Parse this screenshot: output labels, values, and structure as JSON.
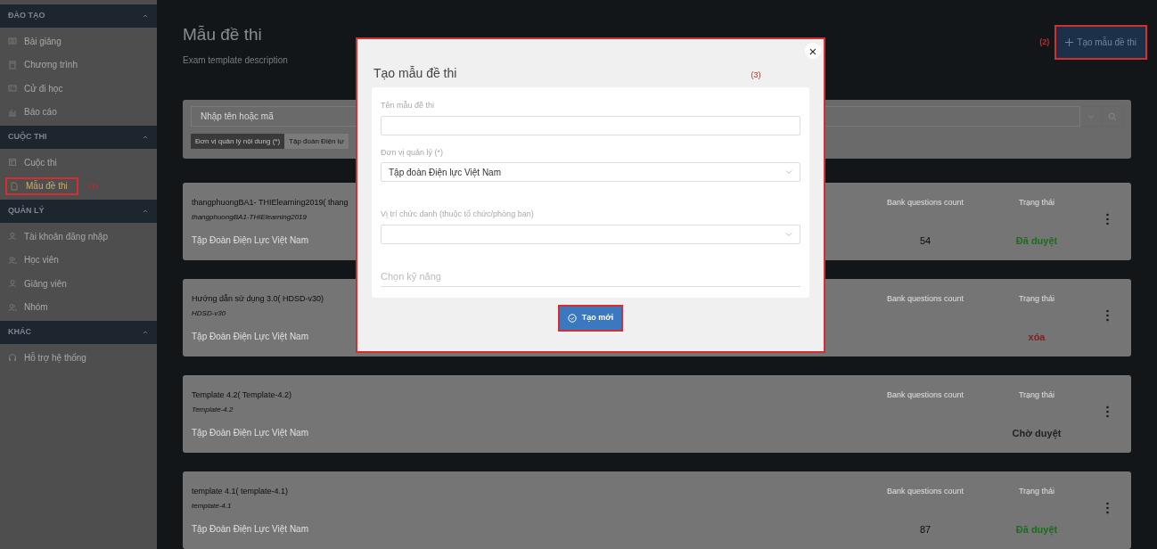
{
  "sidebar": {
    "sections": [
      {
        "title": "ĐÀO TẠO",
        "expanded": true,
        "items": [
          {
            "label": "Bài giảng",
            "selected": false
          },
          {
            "label": "Chương trình",
            "selected": false
          },
          {
            "label": "Cử đi học",
            "selected": false
          },
          {
            "label": "Báo cáo",
            "selected": false
          }
        ]
      },
      {
        "title": "CUỘC THI",
        "expanded": true,
        "items": [
          {
            "label": "Cuộc thi",
            "selected": false
          },
          {
            "label": "Mẫu đề thi",
            "selected": true,
            "highlighted": true,
            "callout": "(1)"
          }
        ]
      },
      {
        "title": "QUẢN LÝ",
        "expanded": true,
        "items": [
          {
            "label": "Tài khoản đăng nhập",
            "selected": false
          },
          {
            "label": "Học viên",
            "selected": false
          },
          {
            "label": "Giảng viên",
            "selected": false
          },
          {
            "label": "Nhóm",
            "selected": false
          }
        ]
      },
      {
        "title": "KHÁC",
        "expanded": true,
        "items": [
          {
            "label": "Hỗ trợ hệ thống",
            "selected": false
          }
        ]
      }
    ]
  },
  "page": {
    "title": "Mẫu đề thi",
    "description": "Exam template description",
    "create_button": {
      "label": "Tạo mẫu đề thi",
      "highlighted": true,
      "callout": "(2)"
    }
  },
  "filter": {
    "search_placeholder": "Nhập tên hoặc mã",
    "tags": [
      "Đơn vị quản lý nội dung (*)",
      "Tập đoàn Điện lự"
    ]
  },
  "templates": [
    {
      "title": "thangphuongBA1- THIElearning2019( thang",
      "code": "thangphuongBA1-THIElearning2019",
      "org": "Tập Đoàn Điện Lực Việt Nam",
      "count_label": "Bank questions count",
      "count": "54",
      "status_label": "Trạng thái",
      "status": "Đã duyệt",
      "color": "#1f6b1f"
    },
    {
      "title": "Hướng dẫn sử dụng 3.0( HDSD-v30)",
      "code": "HDSD-v30",
      "org": "Tập Đoàn Điện Lực Việt Nam",
      "count_label": "Bank questions count",
      "status_label": "Trạng thái",
      "status": "xóa",
      "color": "#8b1a1a"
    },
    {
      "title": "Template 4.2( Template-4.2)",
      "code": "Template-4.2",
      "org": "Tập Đoàn Điện Lực Việt Nam",
      "count_label": "Bank questions count",
      "status_label": "Trạng thái",
      "status": "Chờ duyệt",
      "color": "#222222"
    },
    {
      "title": "template 4.1( template-4.1)",
      "code": "template-4.1",
      "org": "Tập Đoàn Điện Lực Việt Nam",
      "count_label": "Bank questions count",
      "count": "87",
      "status_label": "Trạng thái",
      "status": "Đã duyệt",
      "color": "#1f6b1f"
    }
  ],
  "dialog": {
    "title": "Tạo mẫu đề thi",
    "highlighted": true,
    "callout": "(3)",
    "close": "×",
    "fields": [
      {
        "kind": "text",
        "label": "Tên mẫu đề thi"
      },
      {
        "kind": "select",
        "label": "Đơn vị quản lý (*)",
        "value": "Tập đoàn Điện lực Việt Nam"
      },
      {
        "kind": "select",
        "label": "Vị trí chức danh (thuộc tổ chức/phòng ban)"
      },
      {
        "kind": "underline",
        "placeholder": "Chọn kỹ năng"
      }
    ],
    "submit": {
      "label": "Tạo mới",
      "highlighted": true
    }
  }
}
